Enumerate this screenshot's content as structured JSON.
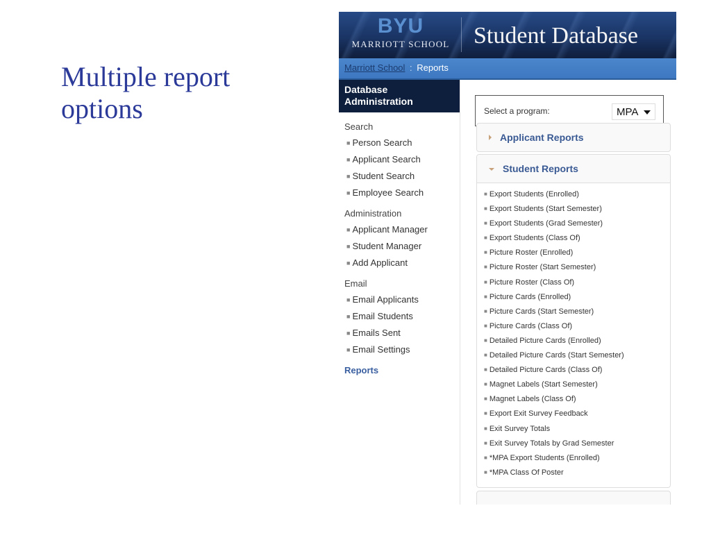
{
  "slide": {
    "title": "Multiple report options"
  },
  "header": {
    "logo_primary": "BYU",
    "logo_secondary": "MARRIOTT SCHOOL",
    "app_title": "Student Database"
  },
  "breadcrumb": {
    "link": "Marriott School",
    "separator": ":",
    "current": "Reports"
  },
  "sidebar": {
    "heading": "Database Administration",
    "sections": [
      {
        "label": "Search",
        "items": [
          "Person Search",
          "Applicant Search",
          "Student Search",
          "Employee Search"
        ]
      },
      {
        "label": "Administration",
        "items": [
          "Applicant Manager",
          "Student Manager",
          "Add Applicant"
        ]
      },
      {
        "label": "Email",
        "items": [
          "Email Applicants",
          "Email Students",
          "Emails Sent",
          "Email Settings"
        ]
      }
    ],
    "active_item": "Reports"
  },
  "program_selector": {
    "label": "Select a program:",
    "selected": "MPA"
  },
  "panels": {
    "applicant_reports": {
      "title": "Applicant Reports",
      "expanded": false
    },
    "student_reports": {
      "title": "Student Reports",
      "expanded": true,
      "items": [
        "Export Students (Enrolled)",
        "Export Students (Start Semester)",
        "Export Students (Grad Semester)",
        "Export Students (Class Of)",
        "Picture Roster (Enrolled)",
        "Picture Roster (Start Semester)",
        "Picture Roster (Class Of)",
        "Picture Cards (Enrolled)",
        "Picture Cards (Start Semester)",
        "Picture Cards (Class Of)",
        "Detailed Picture Cards (Enrolled)",
        "Detailed Picture Cards (Start Semester)",
        "Detailed Picture Cards (Class Of)",
        "Magnet Labels (Start Semester)",
        "Magnet Labels (Class Of)",
        "Export Exit Survey Feedback",
        "Exit Survey Totals",
        "Exit Survey Totals by Grad Semester",
        "*MPA Export Students (Enrolled)",
        "*MPA Class Of Poster"
      ]
    }
  },
  "colors": {
    "slide_title": "#2b3a99",
    "header_dark": "#0d1f3d",
    "breadcrumb_bar": "#4b86cc",
    "panel_title": "#3a5a94",
    "accent_triangle": "#c8a27a"
  }
}
